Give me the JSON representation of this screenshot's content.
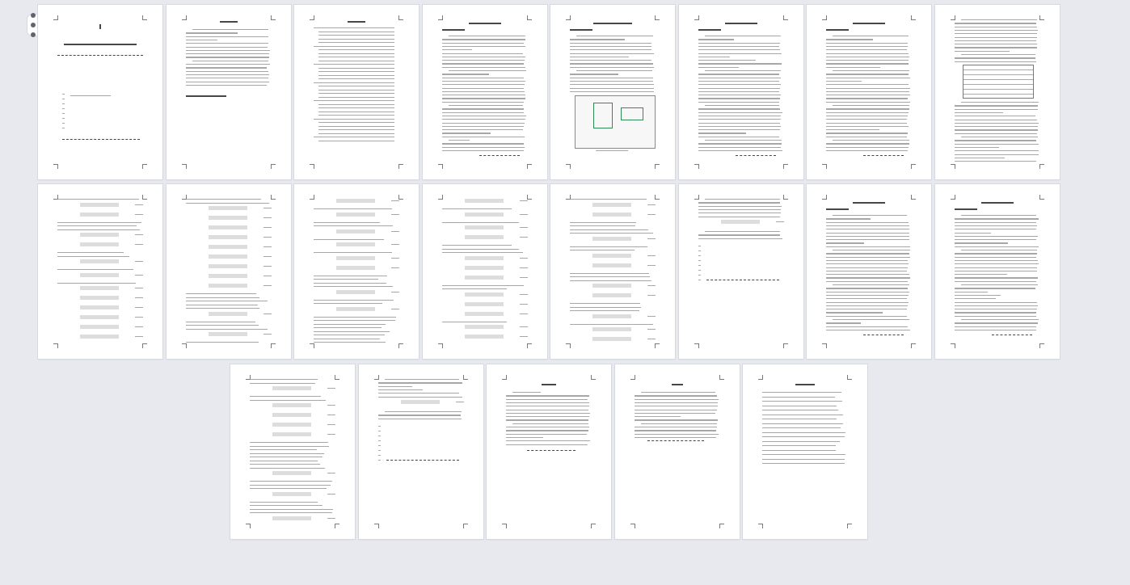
{
  "viewer": {
    "grip_icon": "drag-handle-icon"
  },
  "pages": [
    {
      "row": 0,
      "col": 0,
      "kind": "cover",
      "page_number": ""
    },
    {
      "row": 0,
      "col": 1,
      "kind": "abstract",
      "page_number": ""
    },
    {
      "row": 0,
      "col": 2,
      "kind": "toc",
      "page_number": ""
    },
    {
      "row": 0,
      "col": 3,
      "kind": "text",
      "page_number": ""
    },
    {
      "row": 0,
      "col": 4,
      "kind": "figure",
      "page_number": ""
    },
    {
      "row": 0,
      "col": 5,
      "kind": "text",
      "page_number": ""
    },
    {
      "row": 0,
      "col": 6,
      "kind": "text",
      "page_number": ""
    },
    {
      "row": 0,
      "col": 7,
      "kind": "table",
      "page_number": ""
    },
    {
      "row": 1,
      "col": 0,
      "kind": "equations",
      "page_number": ""
    },
    {
      "row": 1,
      "col": 1,
      "kind": "equations",
      "page_number": ""
    },
    {
      "row": 1,
      "col": 2,
      "kind": "equations",
      "page_number": ""
    },
    {
      "row": 1,
      "col": 3,
      "kind": "equations",
      "page_number": ""
    },
    {
      "row": 1,
      "col": 4,
      "kind": "equations",
      "page_number": ""
    },
    {
      "row": 1,
      "col": 5,
      "kind": "short",
      "page_number": ""
    },
    {
      "row": 1,
      "col": 6,
      "kind": "text",
      "page_number": ""
    },
    {
      "row": 1,
      "col": 7,
      "kind": "text",
      "page_number": ""
    },
    {
      "row": 2,
      "col": 0,
      "kind": "equations",
      "page_number": ""
    },
    {
      "row": 2,
      "col": 1,
      "kind": "short",
      "page_number": ""
    },
    {
      "row": 2,
      "col": 2,
      "kind": "conclusion",
      "page_number": ""
    },
    {
      "row": 2,
      "col": 3,
      "kind": "acknowledgement",
      "page_number": ""
    },
    {
      "row": 2,
      "col": 4,
      "kind": "references",
      "page_number": ""
    }
  ]
}
